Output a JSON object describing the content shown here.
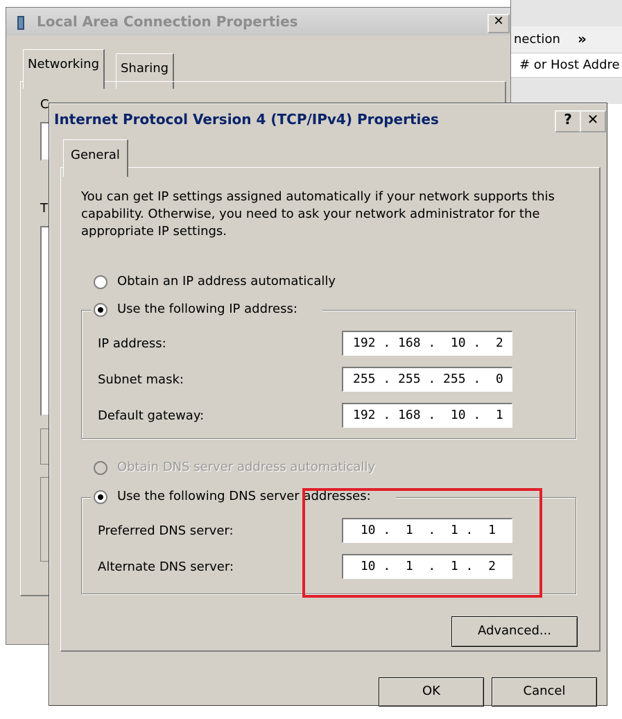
{
  "background_window": {
    "toolbar_text": "nection",
    "toolbar_more": "»",
    "column_header": "# or Host Addre"
  },
  "outer_dialog": {
    "title": "Local Area Connection Properties",
    "close_label": "✕",
    "tabs": [
      {
        "label": "Networking"
      },
      {
        "label": "Sharing"
      }
    ],
    "panel_fragments": {
      "c": "C",
      "t": "T"
    }
  },
  "inner_dialog": {
    "title": "Internet Protocol Version 4 (TCP/IPv4) Properties",
    "help_label": "?",
    "close_label": "✕",
    "tab_general": "General",
    "intro_text": "You can get IP settings assigned automatically if your network supports this capability. Otherwise, you need to ask your network administrator for the appropriate IP settings.",
    "ip_section": {
      "obtain_auto_label": "Obtain an IP address automatically",
      "obtain_auto_selected": false,
      "use_following_label": "Use the following IP address:",
      "use_following_selected": true,
      "fields": [
        {
          "label": "IP address:",
          "value": "192 . 168 .  10 .  2"
        },
        {
          "label": "Subnet mask:",
          "value": "255 . 255 . 255 .  0"
        },
        {
          "label": "Default gateway:",
          "value": "192 . 168 .  10 .  1"
        }
      ]
    },
    "dns_section": {
      "obtain_auto_label": "Obtain DNS server address automatically",
      "obtain_auto_enabled": false,
      "use_following_label": "Use the following DNS server addresses:",
      "use_following_selected": true,
      "fields": [
        {
          "label": "Preferred DNS server:",
          "value": " 10 .  1  .  1 .  1"
        },
        {
          "label": "Alternate DNS server:",
          "value": " 10 .  1  .  1 .  2"
        }
      ]
    },
    "buttons": {
      "advanced": "Advanced...",
      "ok": "OK",
      "cancel": "Cancel"
    }
  },
  "annotation": {
    "highlight_color": "#e0202a"
  }
}
